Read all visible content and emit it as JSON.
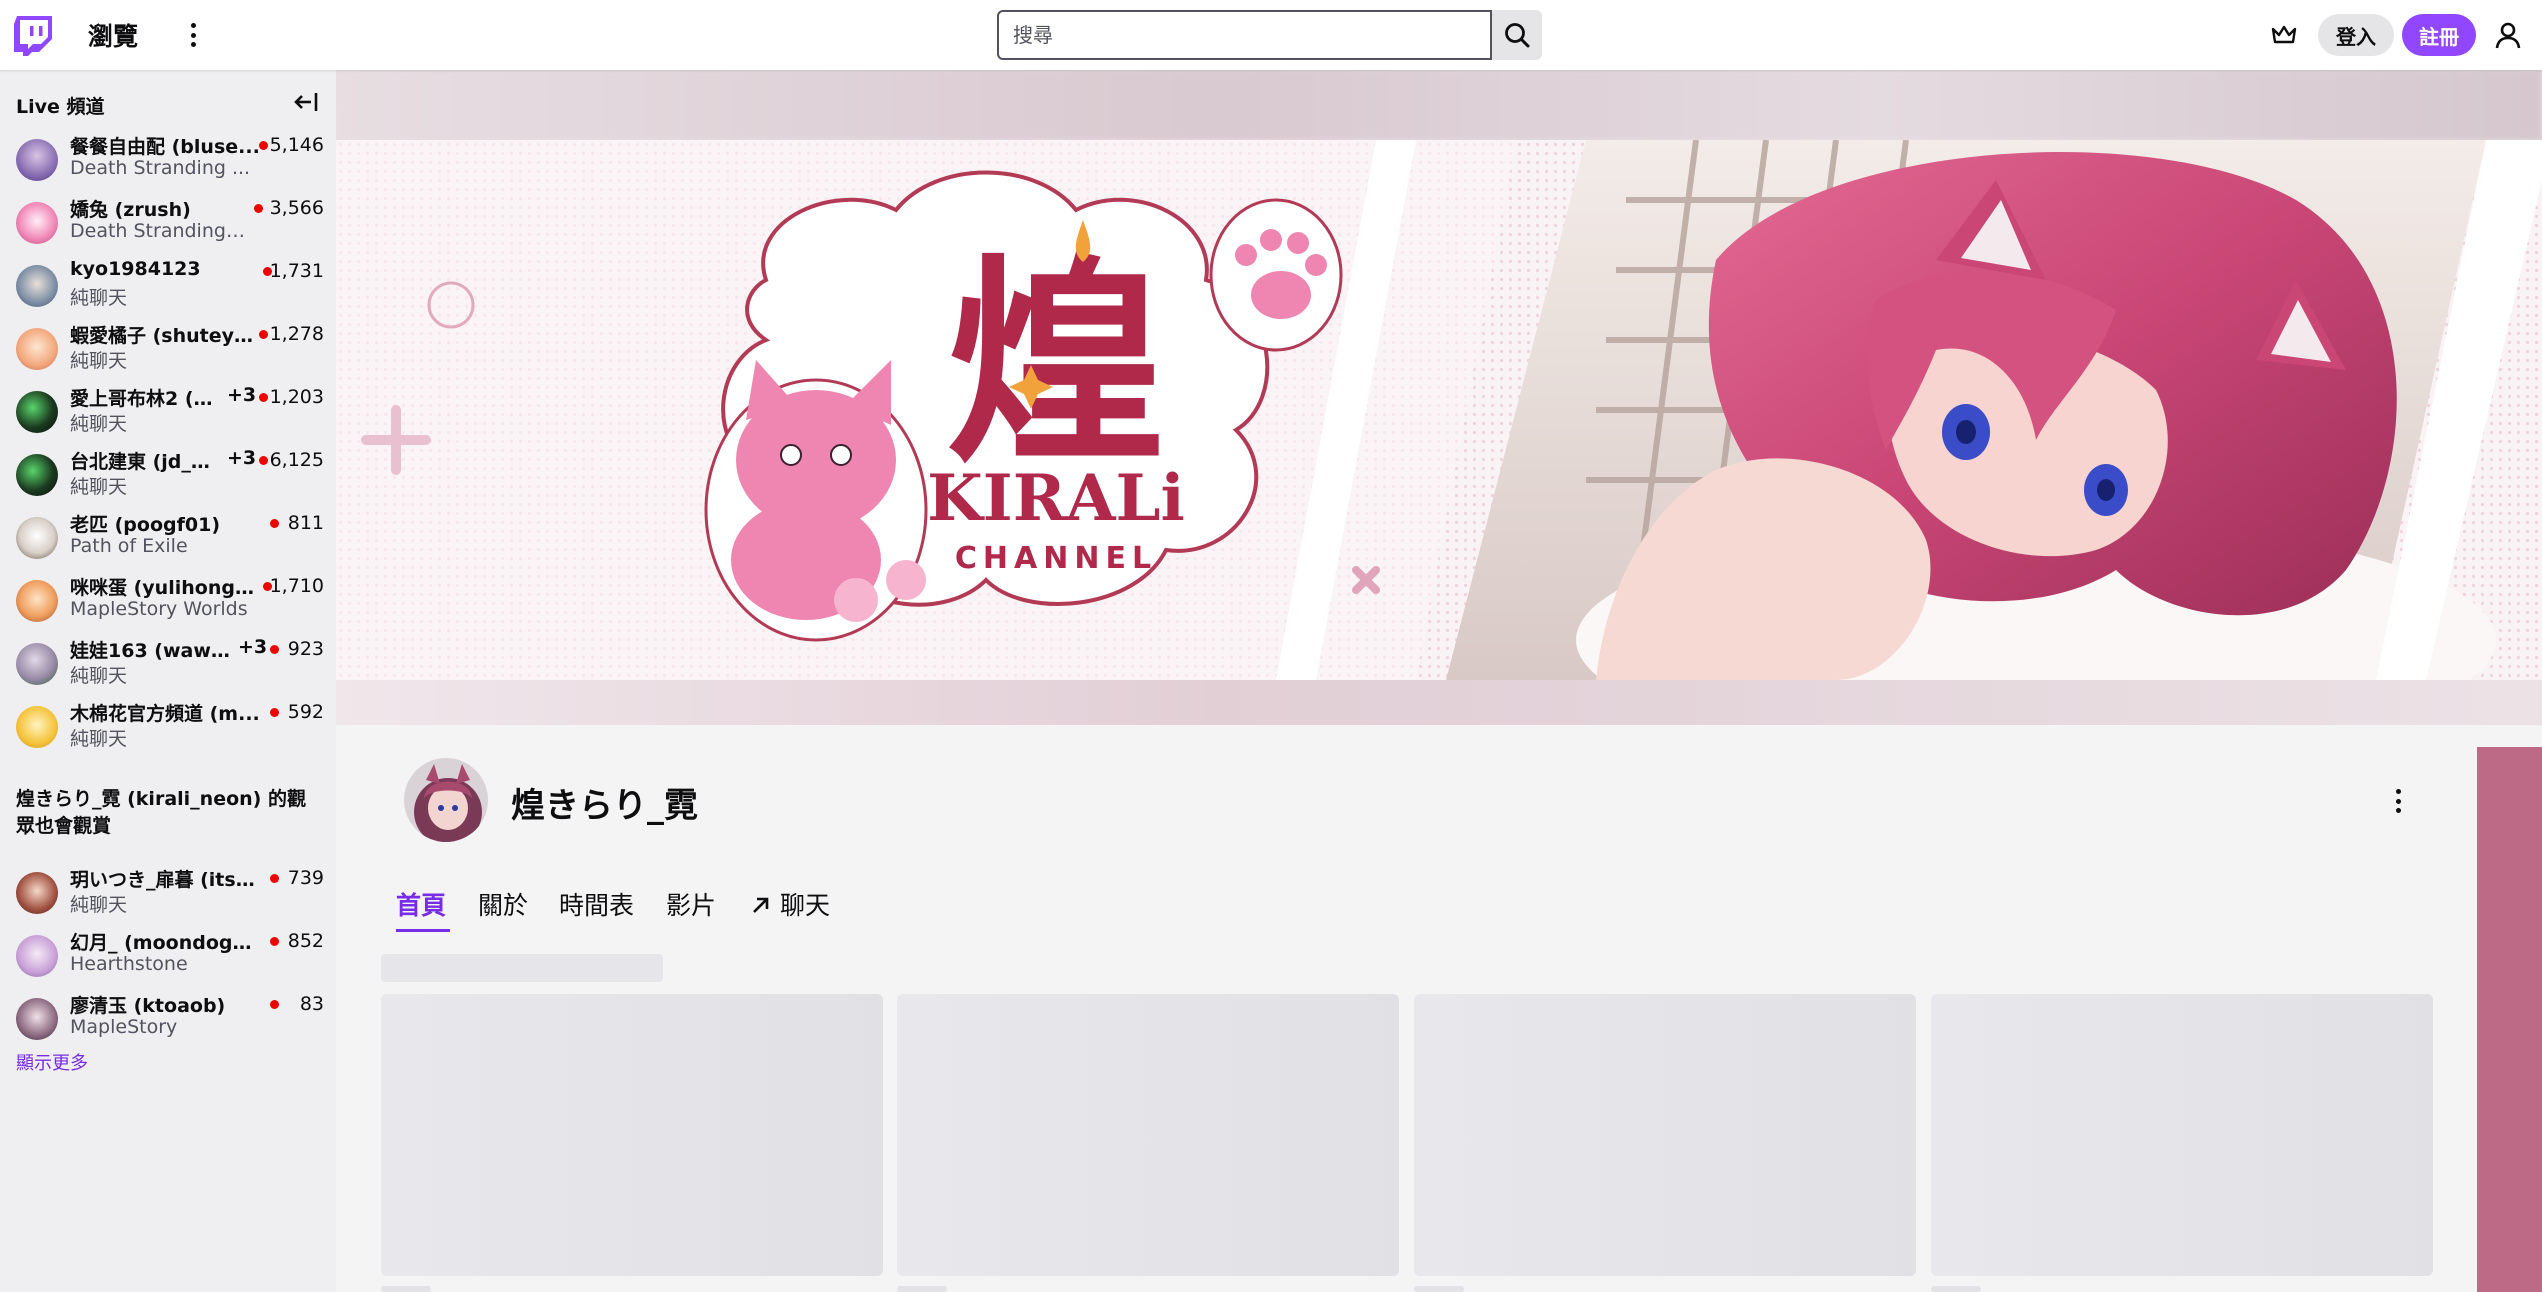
{
  "nav": {
    "browse_label": "瀏覽",
    "search_placeholder": "搜尋",
    "login_label": "登入",
    "signup_label": "註冊"
  },
  "colors": {
    "brand": "#9147ff",
    "live_dot": "#eb0400",
    "link": "#772ce8"
  },
  "sidebar": {
    "live_heading": "Live 頻道",
    "live_channels": [
      {
        "name": "餐餐自由配 (bluse...",
        "game": "Death Stranding ...",
        "extra": "",
        "viewers": "5,146"
      },
      {
        "name": "嬌兔 (zrush)",
        "game": "Death Stranding:...",
        "extra": "",
        "viewers": "3,566"
      },
      {
        "name": "kyo1984123",
        "game": "純聊天",
        "extra": "",
        "viewers": "1,731"
      },
      {
        "name": "蝦愛橘子 (shuteye...",
        "game": "純聊天",
        "extra": "",
        "viewers": "1,278"
      },
      {
        "name": "愛上哥布林2 (l...",
        "game": "純聊天",
        "extra": "+3",
        "viewers": "1,203"
      },
      {
        "name": "台北建東 (jd_o...",
        "game": "純聊天",
        "extra": "+3",
        "viewers": "6,125"
      },
      {
        "name": "老匹 (poogf01)",
        "game": "Path of Exile",
        "extra": "",
        "viewers": "811"
      },
      {
        "name": "咪咪蛋 (yulihong22)",
        "game": "MapleStory Worlds",
        "extra": "",
        "viewers": "1,710"
      },
      {
        "name": "娃娃163 (wawa...",
        "game": "純聊天",
        "extra": "+3",
        "viewers": "923"
      },
      {
        "name": "木棉花官方頻道 (m...",
        "game": "純聊天",
        "extra": "",
        "viewers": "592"
      }
    ],
    "also_watch_heading": "煌きらり_霓 (kirali_neon) 的觀眾也會觀賞",
    "also_watch": [
      {
        "name": "玥いつき_扉暮 (itsu...",
        "game": "純聊天",
        "viewers": "739"
      },
      {
        "name": "幻月_ (moondogs_...",
        "game": "Hearthstone",
        "viewers": "852"
      },
      {
        "name": "廖清玉 (ktoaob)",
        "game": "MapleStory",
        "viewers": "83"
      }
    ],
    "show_more": "顯示更多"
  },
  "banner": {
    "logo_main": "煌",
    "logo_name": "KIRALi",
    "logo_sub": "CHANNEL"
  },
  "channel": {
    "display_name": "煌きらり_霓",
    "tabs": [
      {
        "label": "首頁"
      },
      {
        "label": "關於"
      },
      {
        "label": "時間表"
      },
      {
        "label": "影片"
      },
      {
        "label": "聊天"
      }
    ]
  }
}
